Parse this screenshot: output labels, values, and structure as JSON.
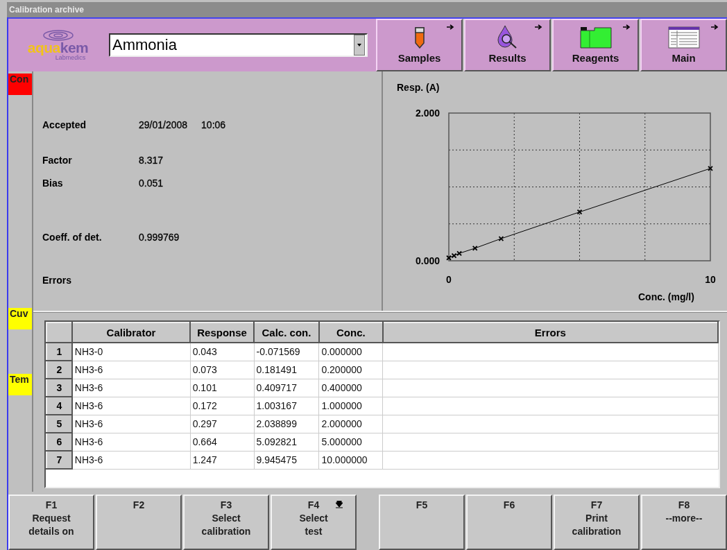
{
  "window": {
    "title": "Calibration archive"
  },
  "header": {
    "logo": {
      "word_a": "aqua",
      "word_b": "kem",
      "sub": "Labmedics"
    },
    "test_select": {
      "value": "Ammonia"
    },
    "nav_buttons": [
      {
        "label": "Samples",
        "kind": "tube"
      },
      {
        "label": "Results",
        "kind": "drop"
      },
      {
        "label": "Reagents",
        "kind": "folder"
      },
      {
        "label": "Main",
        "kind": "table"
      }
    ]
  },
  "status_tags": [
    {
      "label": "Con",
      "color": "#ff0000"
    },
    {
      "label": "Cuv",
      "color": "#ffff00"
    },
    {
      "label": "Tem",
      "color": "#ffff00"
    }
  ],
  "info": [
    {
      "label": "Accepted",
      "values": [
        "29/01/2008",
        "10:06"
      ]
    },
    {
      "label": "Factor",
      "values": [
        "8.317"
      ]
    },
    {
      "label": "Bias",
      "values": [
        "0.051"
      ]
    },
    {
      "label": "Coeff. of det.",
      "values": [
        "0.999769"
      ]
    },
    {
      "label": "Errors"
    }
  ],
  "chart": {
    "chart_data": {
      "type": "line",
      "xlabel": "Conc. (mg/l)",
      "ylabel": "Resp. (A)",
      "x": [
        0,
        0.2,
        0.4,
        1,
        2,
        5,
        10
      ],
      "series": [
        {
          "color": "#000000",
          "marker": "x",
          "values": [
            0.04,
            0.07,
            0.1,
            0.17,
            0.3,
            0.66,
            1.25
          ]
        }
      ],
      "xlim": [
        0,
        10
      ],
      "ylim": [
        0,
        2
      ],
      "xticks": [
        0,
        10
      ],
      "yticks": [
        {
          "value": 0,
          "label": "0.000"
        },
        {
          "value": 2,
          "label": "2.000"
        }
      ]
    }
  },
  "table": {
    "columns": [
      "Calibrator",
      "Response",
      "Calc. con.",
      "Conc.",
      "Errors"
    ],
    "rows": [
      {
        "index": "1",
        "cells": [
          "NH3-0",
          "0.043",
          "-0.071569",
          "0.000000"
        ]
      },
      {
        "index": "2",
        "cells": [
          "NH3-6",
          "0.073",
          "0.181491",
          "0.200000"
        ]
      },
      {
        "index": "3",
        "cells": [
          "NH3-6",
          "0.101",
          "0.409717",
          "0.400000"
        ]
      },
      {
        "index": "4",
        "cells": [
          "NH3-6",
          "0.172",
          "1.003167",
          "1.000000"
        ]
      },
      {
        "index": "5",
        "cells": [
          "NH3-6",
          "0.297",
          "2.038899",
          "2.000000"
        ]
      },
      {
        "index": "6",
        "cells": [
          "NH3-6",
          "0.664",
          "5.092821",
          "5.000000"
        ]
      },
      {
        "index": "7",
        "cells": [
          "NH3-6",
          "1.247",
          "9.945475",
          "10.000000"
        ]
      }
    ]
  },
  "function_keys": [
    {
      "key": "F1",
      "lines": [
        "Request",
        "details on"
      ]
    },
    {
      "key": "F2"
    },
    {
      "key": "F3",
      "lines": [
        "Select",
        "calibration"
      ]
    },
    {
      "key": "F4",
      "lines": [
        "Select",
        "test"
      ],
      "dropdown": true
    },
    {
      "key": "F5"
    },
    {
      "key": "F6"
    },
    {
      "key": "F7",
      "lines": [
        "Print",
        "calibration"
      ]
    },
    {
      "key": "F8",
      "lines": [
        "--more--"
      ]
    }
  ]
}
